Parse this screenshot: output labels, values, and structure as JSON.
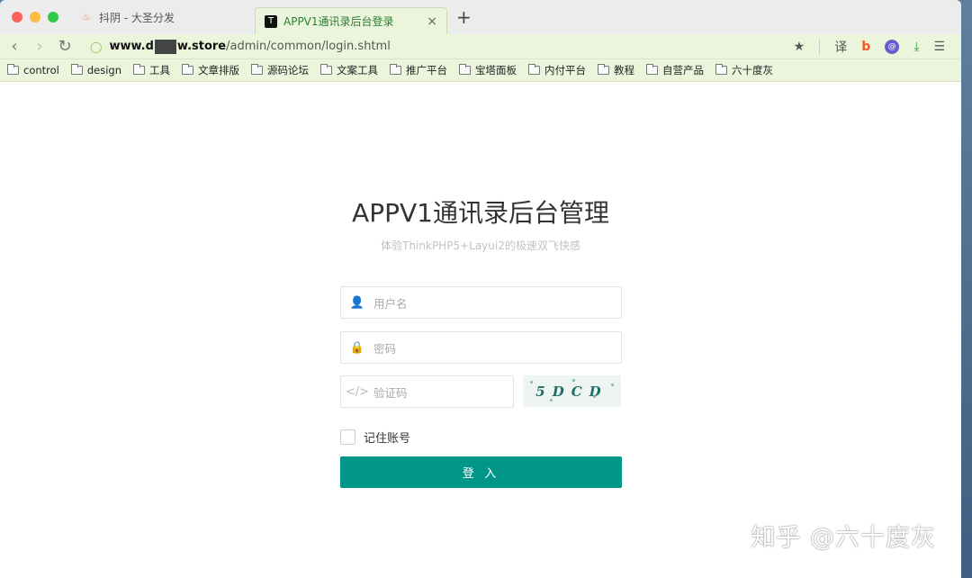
{
  "browser": {
    "tabs": [
      {
        "label": "抖阴 - 大圣分发",
        "icon": "fire-icon"
      },
      {
        "label": "APPV1通讯录后台登录",
        "icon": "t-logo-icon"
      }
    ],
    "close_glyph": "×",
    "new_tab_glyph": "+",
    "url": {
      "host_prefix": "www.d",
      "host_suffix": "w.store",
      "path": "/admin/common/login.shtml"
    },
    "toolbar_icons": {
      "translate": "译",
      "star": "★",
      "menu": "☰"
    },
    "bookmarks": [
      "control",
      "design",
      "工具",
      "文章排版",
      "源码论坛",
      "文案工具",
      "推广平台",
      "宝塔面板",
      "内付平台",
      "教程",
      "自营产品",
      "六十度灰"
    ]
  },
  "login": {
    "title": "APPV1通讯录后台管理",
    "subtitle": "体验ThinkPHP5+Layui2的极速双飞快感",
    "username_placeholder": "用户名",
    "password_placeholder": "密码",
    "captcha_placeholder": "验证码",
    "captcha_text": "5DCD",
    "remember_label": "记住账号",
    "submit_label": "登 入"
  },
  "watermark": "知乎 @六十度灰",
  "colors": {
    "accent": "#009688",
    "toolbar_bg": "#eaf5dc",
    "active_tab_text": "#2e7d32"
  }
}
